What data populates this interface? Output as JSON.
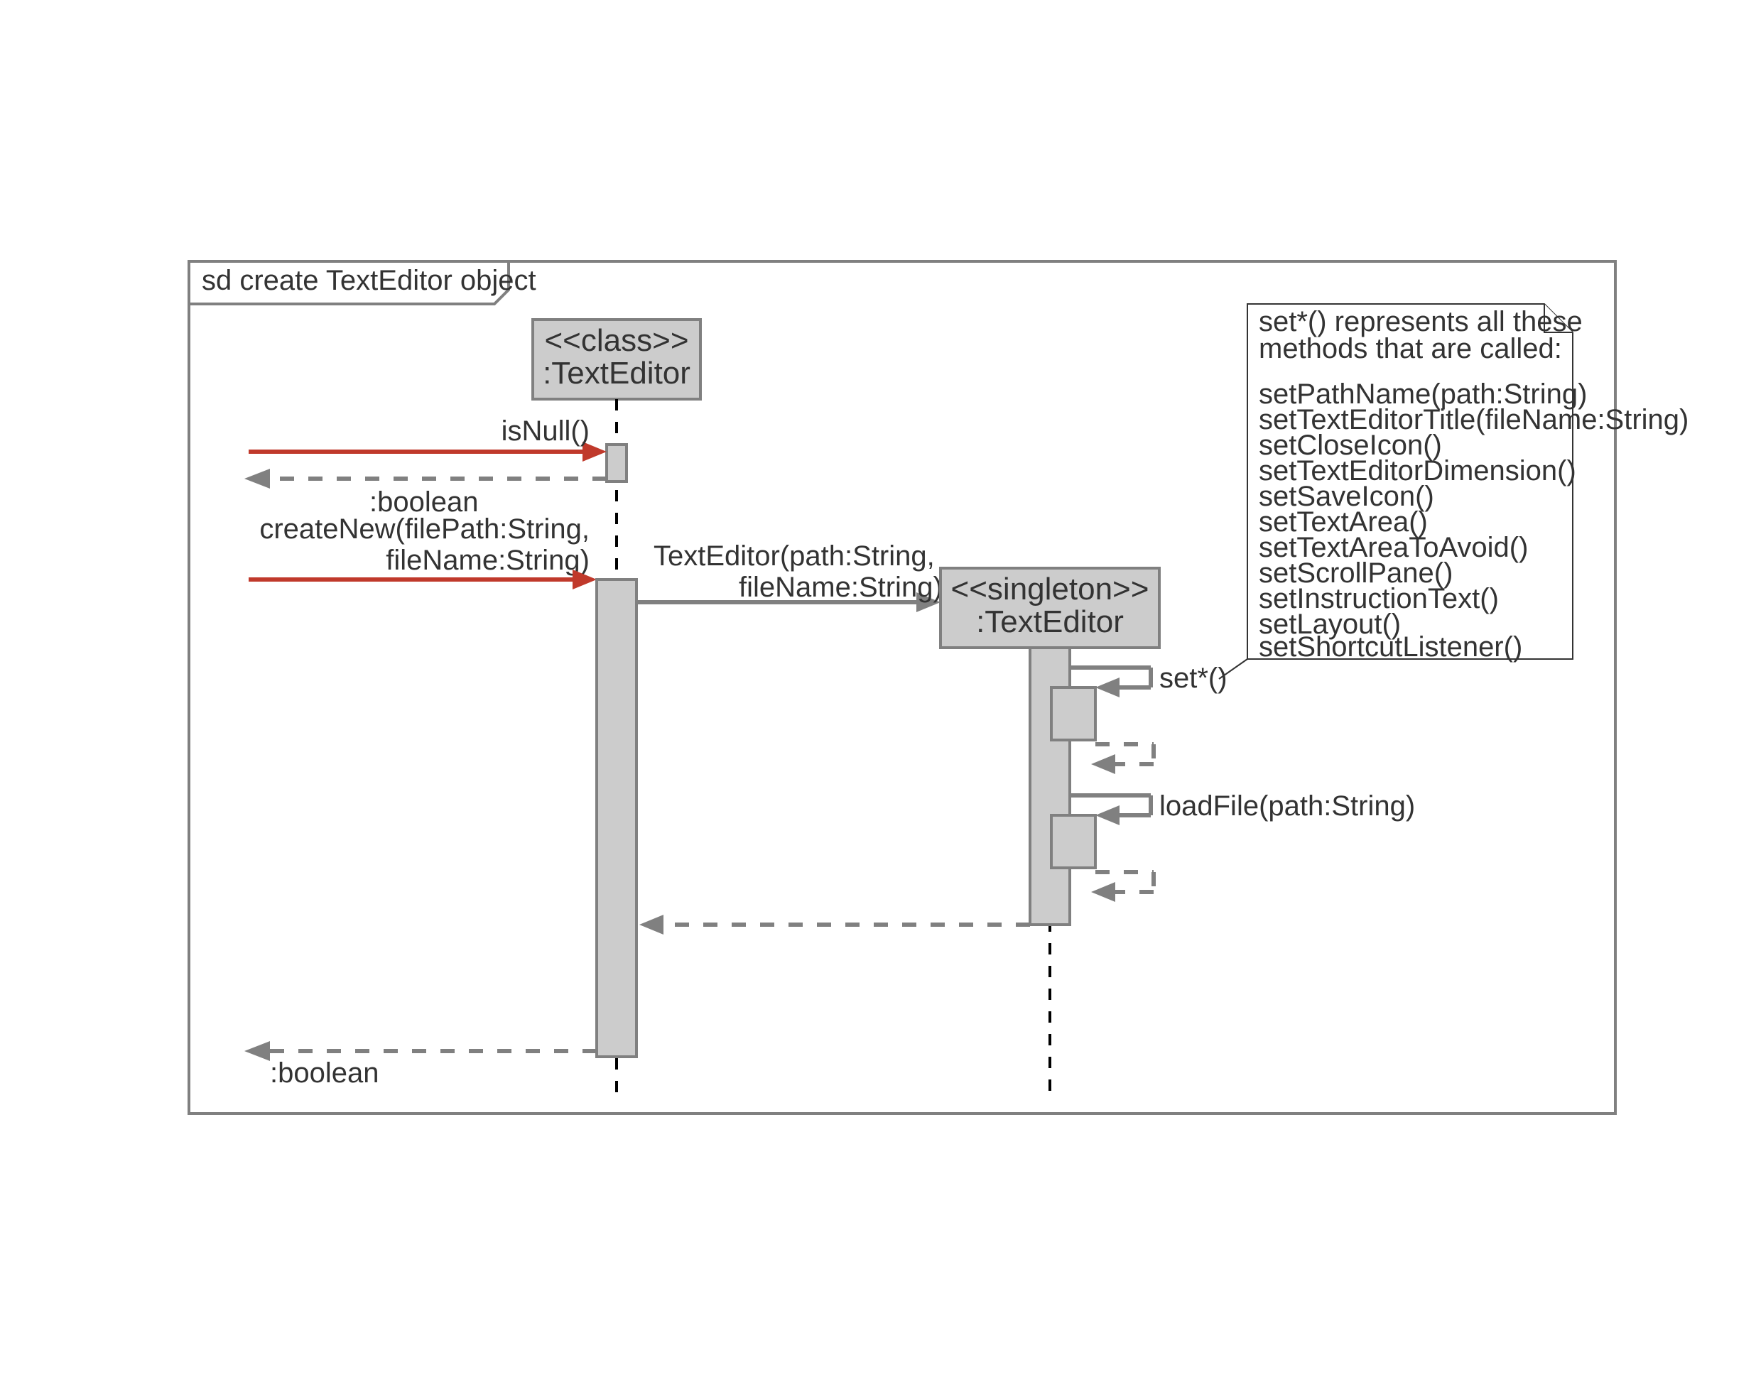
{
  "frame_title": "sd create TextEditor object",
  "participants": {
    "class_stereotype": "<<class>>",
    "class_name": ":TextEditor",
    "singleton_stereotype": "<<singleton>>",
    "singleton_name": ":TextEditor"
  },
  "messages": {
    "isNull": "isNull()",
    "ret_boolean1": ":boolean",
    "createNew_l1": "createNew(filePath:String,",
    "createNew_l2": "fileName:String)",
    "textEditor_l1": "TextEditor(path:String,",
    "textEditor_l2": "fileName:String)",
    "setStar": "set*()",
    "loadFile": "loadFile(path:String)",
    "ret_boolean2": ":boolean"
  },
  "note": {
    "header1": "set*() represents all these",
    "header2": "methods that are called:",
    "lines": [
      "setPathName(path:String)",
      "setTextEditorTitle(fileName:String)",
      "setCloseIcon()",
      "setTextEditorDimension()",
      "setSaveIcon()",
      "setTextArea()",
      "setTextAreaToAvoid()",
      "setScrollPane()",
      "setInstructionText()",
      "setLayout()",
      "setShortcutListener()"
    ]
  }
}
